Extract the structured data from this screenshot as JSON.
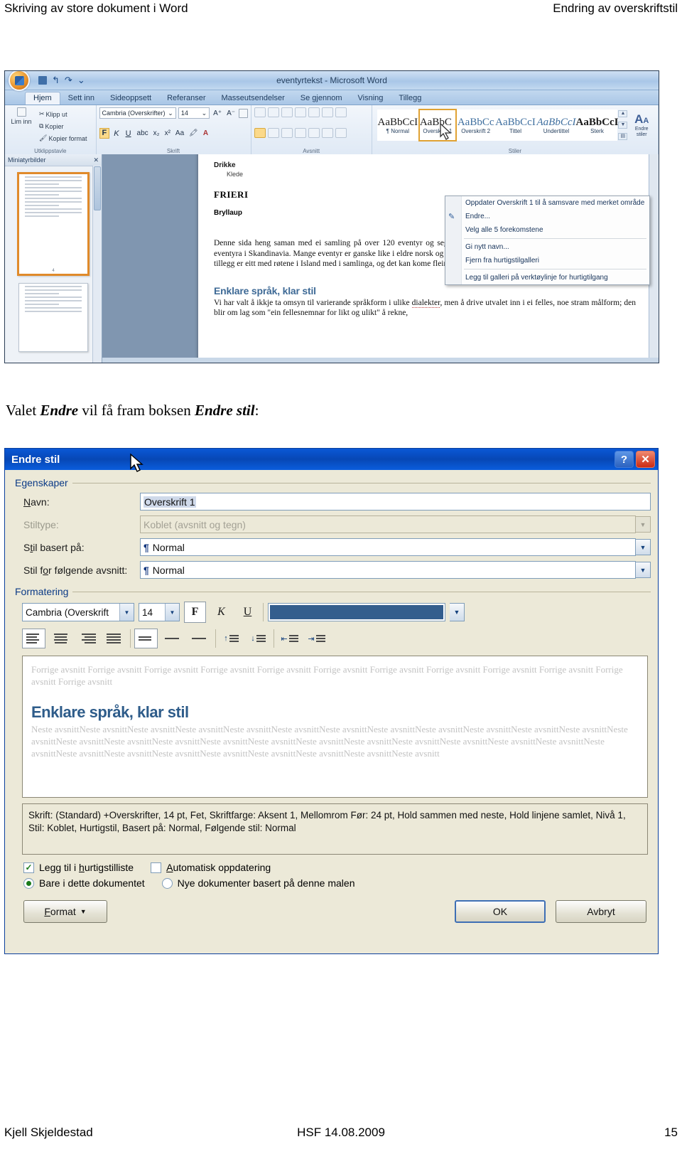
{
  "page": {
    "header_left": "Skriving av store dokument i Word",
    "header_right": "Endring av overskriftstil",
    "footer_left": "Kjell Skjeldestad",
    "footer_center": "HSF 14.08.2009",
    "footer_right": "15"
  },
  "caption": {
    "part1": "Valet ",
    "em1": "Endre",
    "part2": " vil få fram boksen ",
    "em2": "Endre stil",
    "part3": ":"
  },
  "word": {
    "window_title": "eventyrtekst - Microsoft Word",
    "tabs": [
      "Hjem",
      "Sett inn",
      "Sideoppsett",
      "Referanser",
      "Masseutsendelser",
      "Se gjennom",
      "Visning",
      "Tillegg"
    ],
    "clipboard": {
      "group_label": "Utklippstavle",
      "paste": "Lim inn",
      "cut": "Klipp ut",
      "copy": "Kopier",
      "format_painter": "Kopier format"
    },
    "font": {
      "group_label": "Skrift",
      "family": "Cambria (Overskrifter)",
      "size": "14",
      "grow": "A",
      "shrink": "A",
      "bold": "F",
      "italic": "K",
      "underline": "U",
      "strike": "abc",
      "subscript": "x₂",
      "superscript": "x²",
      "change_case": "Aa",
      "highlight": "ab",
      "font_color": "A"
    },
    "paragraph": {
      "group_label": "Avsnitt"
    },
    "styles": {
      "group_label": "Stiler",
      "edit_label": "Endre stiler",
      "items": [
        {
          "sample": "AaBbCcI",
          "name": "¶ Normal",
          "variant": "plain"
        },
        {
          "sample": "AaBbC­",
          "name": "Overskrift 1",
          "variant": "selected"
        },
        {
          "sample": "AaBbCc",
          "name": "Overskrift 2",
          "variant": "blue"
        },
        {
          "sample": "AaBbCcI",
          "name": "Tittel",
          "variant": "blue"
        },
        {
          "sample": "AaBbCcI",
          "name": "Undertittel",
          "variant": "italic"
        },
        {
          "sample": "AaBbCcI",
          "name": "Sterk",
          "variant": "bold"
        }
      ]
    },
    "context_menu": [
      "Oppdater Overskrift 1 til å samsvare med merket område",
      "Endre...",
      "Velg alle 5 forekomstene",
      "Gi nytt navn...",
      "Fjern fra hurtigstilgalleri",
      "Legg til galleri på verktøylinje for hurtigtilgang"
    ],
    "thumbnail_pane_title": "Miniatyrbilder",
    "document": {
      "line_drikke": "Drikke",
      "line_klede": "Klede",
      "line_frieri": "FRIERI",
      "line_bryllaup": "Bryllaup",
      "page_number": "5",
      "paragraph1": "Denne sida heng saman med ei samling på over 120 eventyr og segner. Samlinga femner over rett mange av dei kjekkaste eventyra i Skandinavia. Mange eventyr er ganske like i eldre norsk og svensk fasong, og danske variantar finst også her og der. I tillegg er eitt med røtene i Island med i samlinga, og det kan kome fleire derifrå, og ifrå Finland.",
      "heading2": "Enklare språk, klar stil",
      "paragraph2_a": "Vi har valt å ikkje ta omsyn til varierande språkform i ulike ",
      "paragraph2_squig": "dialekter",
      "paragraph2_b": ", men å drive utvalet inn i ei felles, noe stram målform; den blir om lag som \"ein fellesnemnar for likt og ulikt\" å rekne,"
    }
  },
  "dialog": {
    "title": "Endre stil",
    "help_button": "?",
    "close_button": "✕",
    "properties_group": "Egenskaper",
    "fields": {
      "name_label": "Navn:",
      "name_value": "Overskrift 1",
      "styletype_label": "Stiltype:",
      "styletype_value": "Koblet (avsnitt og tegn)",
      "basedon_label": "Stil basert på:",
      "basedon_value": "Normal",
      "nextstyle_label": "Stil for følgende avsnitt:",
      "nextstyle_value": "Normal"
    },
    "formatting_group": "Formatering",
    "formatting": {
      "font_family": "Cambria (Overskrift",
      "font_size": "14",
      "bold": "F",
      "italic": "K",
      "underline": "U",
      "color_hex": "#345e8d"
    },
    "preview": {
      "before_text": "Forrige avsnitt Forrige avsnitt Forrige avsnitt Forrige avsnitt Forrige avsnitt Forrige avsnitt Forrige avsnitt Forrige avsnitt Forrige avsnitt Forrige avsnitt Forrige avsnitt Forrige avsnitt",
      "heading": "Enklare språk, klar stil",
      "after_text": "Neste avsnittNeste avsnittNeste avsnittNeste avsnittNeste avsnittNeste avsnittNeste avsnittNeste avsnittNeste avsnittNeste avsnittNeste avsnittNeste avsnittNeste avsnittNeste avsnittNeste avsnittNeste avsnittNeste avsnittNeste avsnittNeste avsnittNeste avsnittNeste avsnittNeste avsnittNeste avsnittNeste avsnittNeste avsnittNeste avsnittNeste avsnittNeste avsnittNeste avsnittNeste avsnittNeste avsnittNeste avsnittNeste avsnitt"
    },
    "description": "Skrift: (Standard) +Overskrifter, 14 pt, Fet, Skriftfarge: Aksent 1, Mellomrom Før:  24 pt, Hold sammen med neste, Hold linjene samlet, Nivå 1, Stil: Koblet, Hurtigstil, Basert på: Normal, Følgende stil: Normal",
    "options": {
      "add_quickstyle": "Legg til i hurtigstilliste",
      "auto_update": "Automatisk oppdatering",
      "only_this_doc": "Bare i dette dokumentet",
      "new_docs": "Nye dokumenter basert på denne malen"
    },
    "buttons": {
      "format": "Format",
      "ok": "OK",
      "cancel": "Avbryt"
    }
  }
}
